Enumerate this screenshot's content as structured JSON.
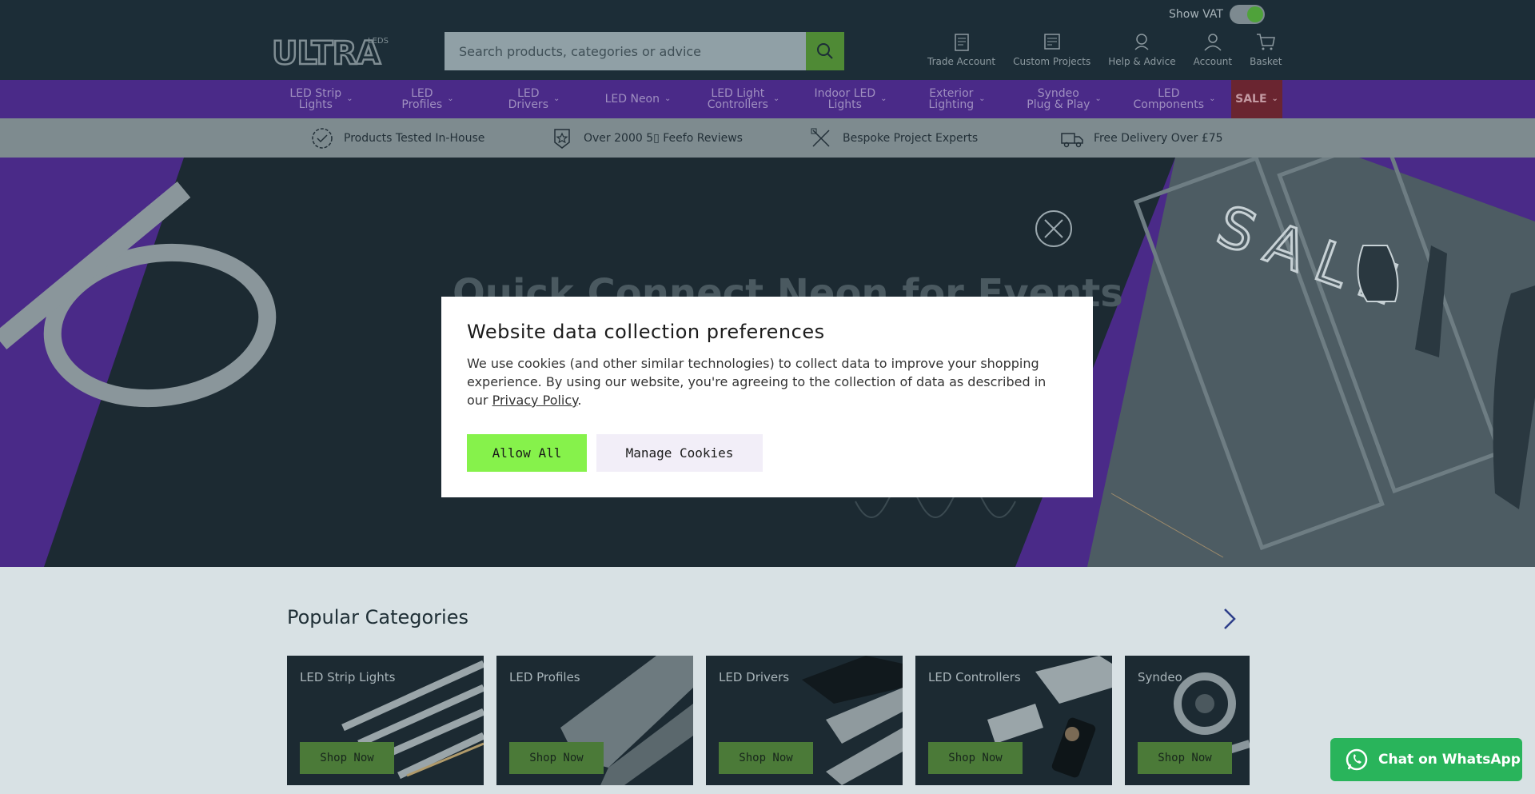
{
  "header": {
    "vat_label": "Show VAT",
    "logo_text": "ULTRA",
    "logo_sub": "LEDS",
    "search_placeholder": "Search products, categories or advice",
    "icons": [
      {
        "label": "Trade Account",
        "icon": "trade-account-icon"
      },
      {
        "label": "Custom Projects",
        "icon": "custom-projects-icon"
      },
      {
        "label": "Help & Advice",
        "icon": "help-advice-icon"
      },
      {
        "label": "Account",
        "icon": "account-icon"
      },
      {
        "label": "Basket",
        "icon": "basket-icon"
      }
    ]
  },
  "nav": {
    "items": [
      {
        "line1": "LED Strip",
        "line2": "Lights"
      },
      {
        "line1": "LED",
        "line2": "Profiles"
      },
      {
        "line1": "LED",
        "line2": "Drivers"
      },
      {
        "line1": "LED Neon",
        "line2": ""
      },
      {
        "line1": "LED Light",
        "line2": "Controllers"
      },
      {
        "line1": "Indoor LED",
        "line2": "Lights"
      },
      {
        "line1": "Exterior",
        "line2": "Lighting"
      },
      {
        "line1": "Syndeo",
        "line2": "Plug & Play"
      },
      {
        "line1": "LED",
        "line2": "Components"
      },
      {
        "line1": "SALE",
        "line2": ""
      }
    ]
  },
  "usp": [
    {
      "label": "Products Tested In-House"
    },
    {
      "label": "Over 2000 5▯ Feefo Reviews"
    },
    {
      "label": "Bespoke Project Experts"
    },
    {
      "label": "Free Delivery Over £75"
    }
  ],
  "hero": {
    "title": "Quick Connect Neon for Events",
    "sign_text": "SALE"
  },
  "popular": {
    "title": "Popular Categories",
    "cards": [
      {
        "label": "LED Strip Lights",
        "button": "Shop Now"
      },
      {
        "label": "LED Profiles",
        "button": "Shop Now"
      },
      {
        "label": "LED Drivers",
        "button": "Shop Now"
      },
      {
        "label": "LED Controllers",
        "button": "Shop Now"
      },
      {
        "label": "Syndeo",
        "button": "Shop Now"
      }
    ]
  },
  "whatsapp": {
    "label": "Chat on WhatsApp"
  },
  "modal": {
    "title": "Website data collection preferences",
    "body": "We use cookies (and other similar technologies) to collect data to improve your shopping experience. By using our website, you're agreeing to the collection of data as described in our ",
    "link": "Privacy Policy",
    "body_end": ".",
    "allow": "Allow All",
    "manage": "Manage Cookies"
  }
}
